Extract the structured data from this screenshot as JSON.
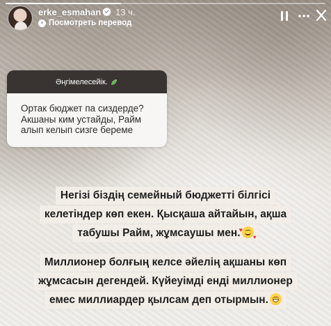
{
  "story": {
    "progress": 0.36,
    "username": "erke_esmahan",
    "time_ago": "13 ч.",
    "translate_label": "Посмотреть перевод",
    "icons": {
      "verified": "verified-badge-icon",
      "translate": "translate-icon",
      "pause": "pause-icon",
      "more": "more-icon",
      "close": "close-icon"
    }
  },
  "question": {
    "header": "Әңгімелесейік.",
    "text": "Ортак бюджет па сиздерде? Акшаны ким устайды, Райм алып келып сизге береме"
  },
  "answer": {
    "paragraph1": [
      "Негізі біздің семейный бюджетті білгісі",
      "келетіндер көп екен. Қысқаша айтайын, ақша",
      "табушы Райм, жұмсаушы мен."
    ],
    "paragraph2": [
      "Миллионер болғың келсе әйелің ақшаны көп",
      "жұмсасын дегендей. Күйеуімді енді миллионер",
      "емес миллиардер қылсам деп отырмын."
    ]
  },
  "colors": {
    "text_highlight": "#f2ede7",
    "card_header": "#393432",
    "card_body": "#f7f6f4"
  }
}
